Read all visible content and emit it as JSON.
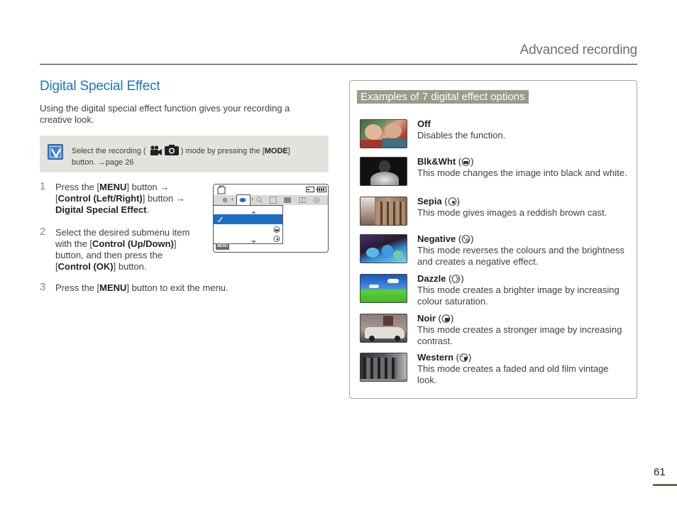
{
  "header": {
    "section_title": "Advanced recording"
  },
  "main": {
    "heading": "Digital Special Effect",
    "intro": "Using the digital special effect function gives your recording a creative look.",
    "note": {
      "icon": "checkmark-note-icon",
      "text_before": "Select the recording (",
      "text_icons": [
        "video-camera-icon",
        "photo-camera-icon"
      ],
      "text_middle": ") mode by pressing the [",
      "mode_label": "MODE",
      "text_after": "]",
      "line2_prefix": "button.",
      "page_ref": "page 26"
    },
    "steps": [
      {
        "number": "1",
        "parts": {
          "a": "Press the [",
          "b": "MENU",
          "c": "] button →",
          "d": "[",
          "e": "Control (Left/Right)",
          "f": "] button →",
          "g": "Digital Special Effect",
          "h": "."
        }
      },
      {
        "number": "2",
        "parts": {
          "a": "Select the desired submenu item with the [",
          "b": "Control (Up/Down)",
          "c": "] button, and then press the [",
          "d": "Control (OK)",
          "e": "] button."
        }
      },
      {
        "number": "3",
        "parts": {
          "a": "Press the [",
          "b": "MENU",
          "c": "] button to exit the menu."
        }
      }
    ],
    "lcd": {
      "menu_button": "MENU",
      "accent": "#1f6dbf"
    }
  },
  "examples": {
    "title": "Examples of 7 digital effect options",
    "items": [
      {
        "name": "Off",
        "icon": "",
        "description": "Disables the function."
      },
      {
        "name": "Blk&Wht",
        "icon": "bw-effect-icon",
        "description": "This mode changes the image into black and white."
      },
      {
        "name": "Sepia",
        "icon": "sepia-effect-icon",
        "description": "This mode gives images a reddish brown cast."
      },
      {
        "name": "Negative",
        "icon": "negative-effect-icon",
        "description": "This mode reverses the colours and the brightness and creates a negative effect."
      },
      {
        "name": "Dazzle",
        "icon": "dazzle-effect-icon",
        "description": "This mode creates a brighter image by increasing colour saturation."
      },
      {
        "name": "Noir",
        "icon": "noir-effect-icon",
        "description": "This mode creates a stronger image by increasing contrast."
      },
      {
        "name": "Western",
        "icon": "western-effect-icon",
        "description": "This mode creates a faded and old film vintage look."
      }
    ]
  },
  "footer": {
    "page_number": "61"
  },
  "colors": {
    "heading_blue": "#1f73c0",
    "title_bar": "#9c9a88",
    "note_bg": "#e3e2dc",
    "page_bar": "#6d6a55"
  }
}
